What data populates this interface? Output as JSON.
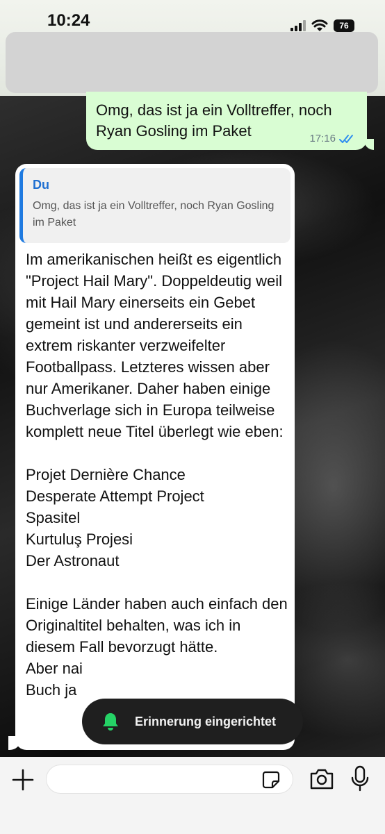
{
  "status_bar": {
    "time": "10:24",
    "battery": "76"
  },
  "messages": {
    "outgoing": {
      "text": "Omg, das ist ja ein Volltreffer, noch Ryan Gosling im Paket",
      "time": "17:16",
      "status_icon": "double-check-icon"
    },
    "incoming": {
      "quote_author": "Du",
      "quote_text": "Omg, das ist ja ein Volltreffer, noch Ryan Gosling im Paket",
      "text": "Im amerikanischen heißt es eigentlich \"Project Hail Mary\". Doppeldeutig weil mit Hail Mary einerseits ein Gebet gemeint ist und andererseits ein extrem riskanter verzweifelter Footballpass. Letzteres wissen aber nur Amerikaner. Daher haben einige Buchverlage sich in Europa teilweise komplett neue Titel überlegt wie eben:\n\nProjet Dernière Chance\nDesperate Attempt Project\nSpasitel\nKurtuluş Projesi\nDer Astronaut\n\nEinige Länder haben auch einfach den Originaltitel behalten, was ich in diesem Fall bevorzugt hätte.\nAber nai\nBuch ja"
    }
  },
  "toast": {
    "icon": "bell-icon",
    "text": "Erinnerung eingerichtet"
  },
  "input_bar": {
    "value": "",
    "placeholder": ""
  },
  "colors": {
    "outgoing_bubble": "#d9fdd3",
    "incoming_bubble": "#ffffff",
    "quote_accent": "#1f7ae0",
    "read_ticks": "#2f8ef0",
    "toast_icon": "#25d366"
  }
}
